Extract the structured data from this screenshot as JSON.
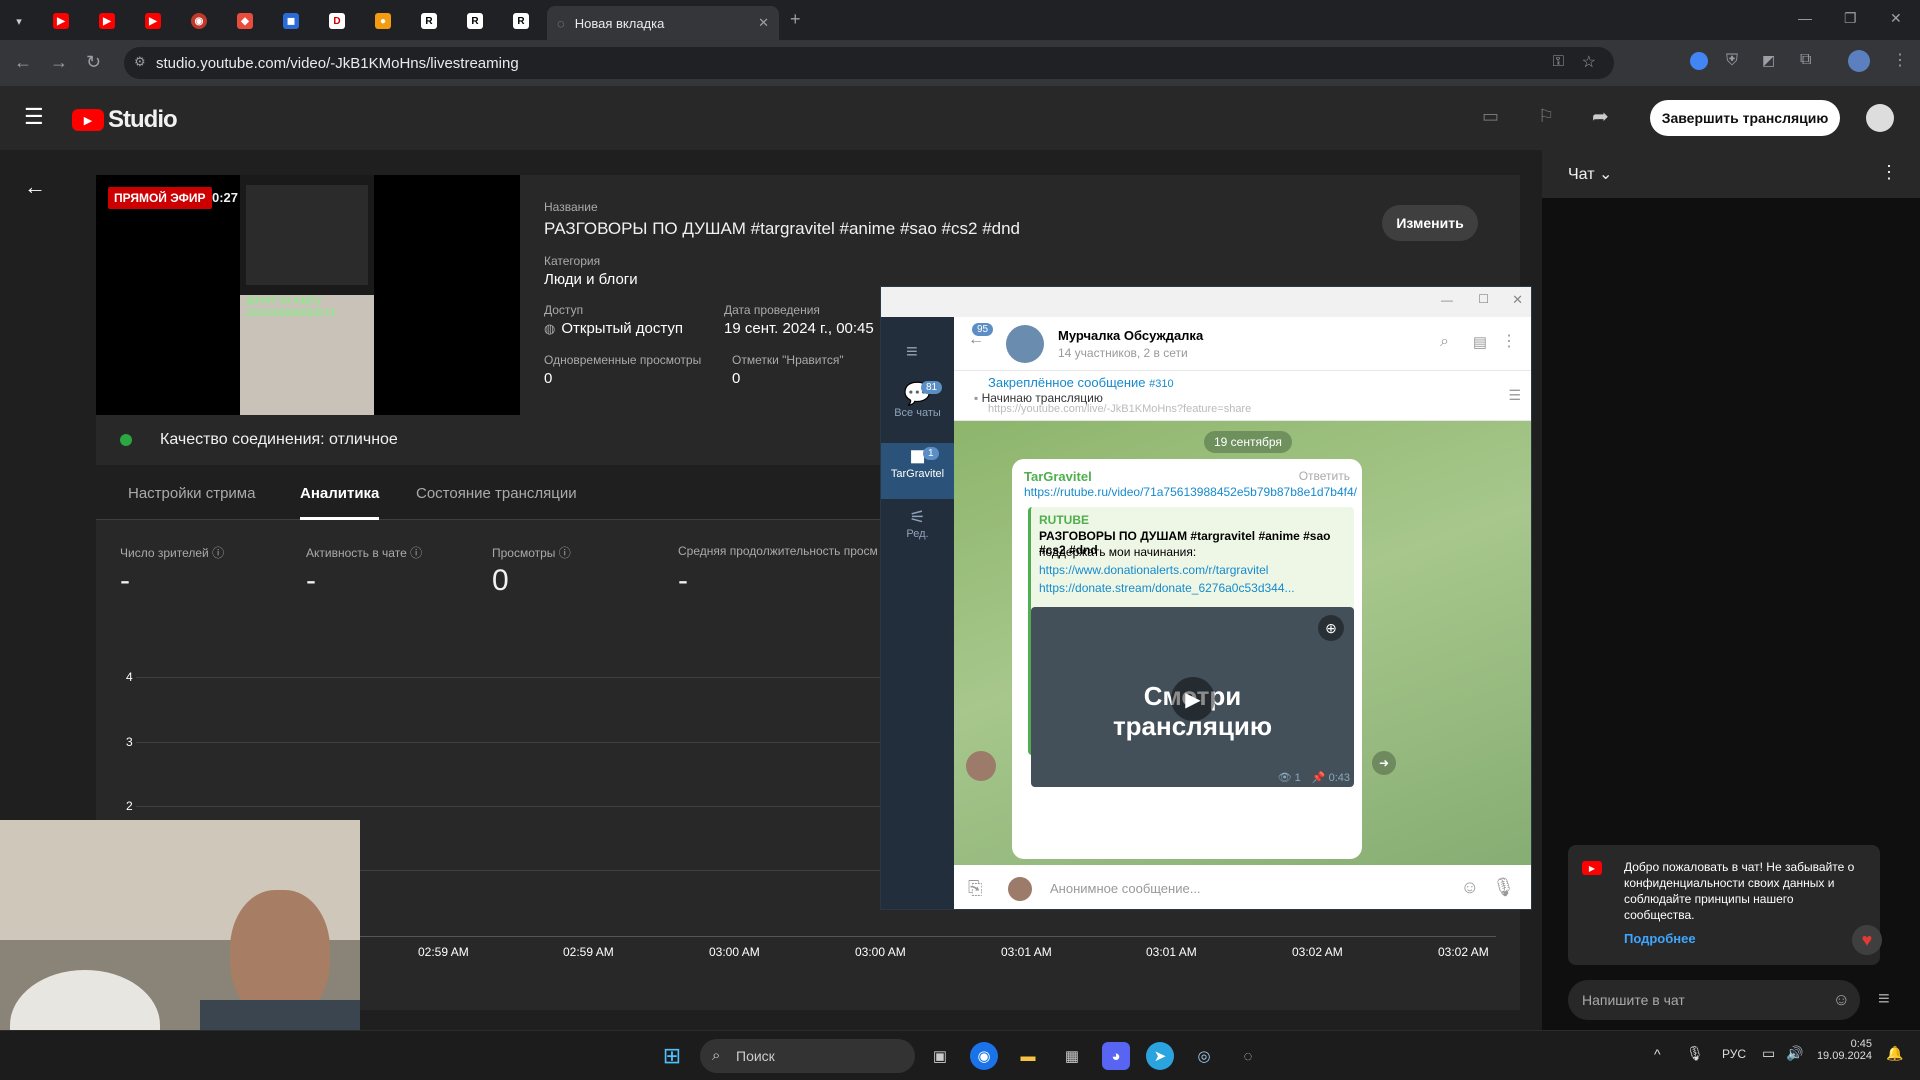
{
  "browser": {
    "active_tab_title": "Новая вкладка",
    "url": "studio.youtube.com/video/-JkB1KMoHns/livestreaming"
  },
  "studio": {
    "logo_text": "Studio",
    "end_stream_button": "Завершить трансляцию"
  },
  "preview": {
    "live_badge": "ПРЯМОЙ ЭФИР",
    "duration": "0:27",
    "overlay_text_1": "донат на карту",
    "overlay_text_2": "2202206895084574"
  },
  "stream_info": {
    "title_label": "Название",
    "title": "РАЗГОВОРЫ ПО ДУШАМ #targravitel #anime #sao #cs2 #dnd",
    "category_label": "Категория",
    "category": "Люди и блоги",
    "access_label": "Доступ",
    "access": "Открытый доступ",
    "date_label": "Дата проведения",
    "date": "19 сент. 2024 г., 00:45",
    "viewers_label": "Одновременные просмотры",
    "viewers": "0",
    "likes_label": "Отметки \"Нравится\"",
    "likes": "0",
    "edit_button": "Изменить"
  },
  "connection": {
    "quality": "Качество соединения: отличное",
    "status_color": "#2ba640"
  },
  "tabs": [
    "Настройки стрима",
    "Аналитика",
    "Состояние трансляции"
  ],
  "metrics": {
    "viewers_label": "Число зрителей",
    "viewers_value": "-",
    "chat_label": "Активность в чате",
    "chat_value": "-",
    "views_label": "Просмотры",
    "views_value": "0",
    "duration_label": "Средняя продолжительность просм",
    "duration_value": "-"
  },
  "chart_data": {
    "type": "line",
    "y_ticks": [
      "4",
      "3",
      "2"
    ],
    "x_ticks": [
      "02:59 AM",
      "02:59 AM",
      "03:00 AM",
      "03:00 AM",
      "03:01 AM",
      "03:01 AM",
      "03:02 AM",
      "03:02 AM"
    ]
  },
  "chat": {
    "header": "Чат",
    "welcome_text": "Добро пожаловать в чат! Не забывайте о конфиденциальности своих данных и соблюдайте принципы нашего сообщества.",
    "more_link": "Подробнее",
    "input_placeholder": "Напишите в чат"
  },
  "telegram": {
    "back_badge": "95",
    "chat_name": "Мурчалка Обсуждалка",
    "chat_sub": "14 участников, 2 в сети",
    "sidebar_all_chats": "Все чаты",
    "sidebar_all_badge": "81",
    "sidebar_targravitel": "TarGravitel",
    "sidebar_targravitel_badge": "1",
    "sidebar_edit": "Ред.",
    "pinned_label": "Закреплённое сообщение",
    "pinned_num": "#310",
    "pinned_text": "Начинаю трансляцию",
    "pinned_link": "https://youtube.com/live/-JkB1KMoHns?feature=share",
    "date_pill": "19 сентября",
    "msg_author": "TarGravitel",
    "msg_reply": "Ответить",
    "msg_link": "https://rutube.ru/video/71a75613988452e5b79b87b8e1d7b4f4/",
    "embed_site": "RUTUBE",
    "embed_title": "РАЗГОВОРЫ ПО ДУШАМ #targravitel #anime #sao #cs2 #dnd",
    "embed_desc": "поддержать мои начинания:",
    "embed_link1": "https://www.donationalerts.com/r/targravitel",
    "embed_link2": "https://donate.stream/donate_6276a0c53d344...",
    "video_text_1": "Смотри",
    "video_text_2": "трансляцию",
    "views": "1",
    "time": "0:43",
    "input_placeholder": "Анонимное сообщение..."
  },
  "taskbar": {
    "search": "Поиск",
    "lang": "РУС",
    "time": "0:45",
    "date": "19.09.2024"
  }
}
